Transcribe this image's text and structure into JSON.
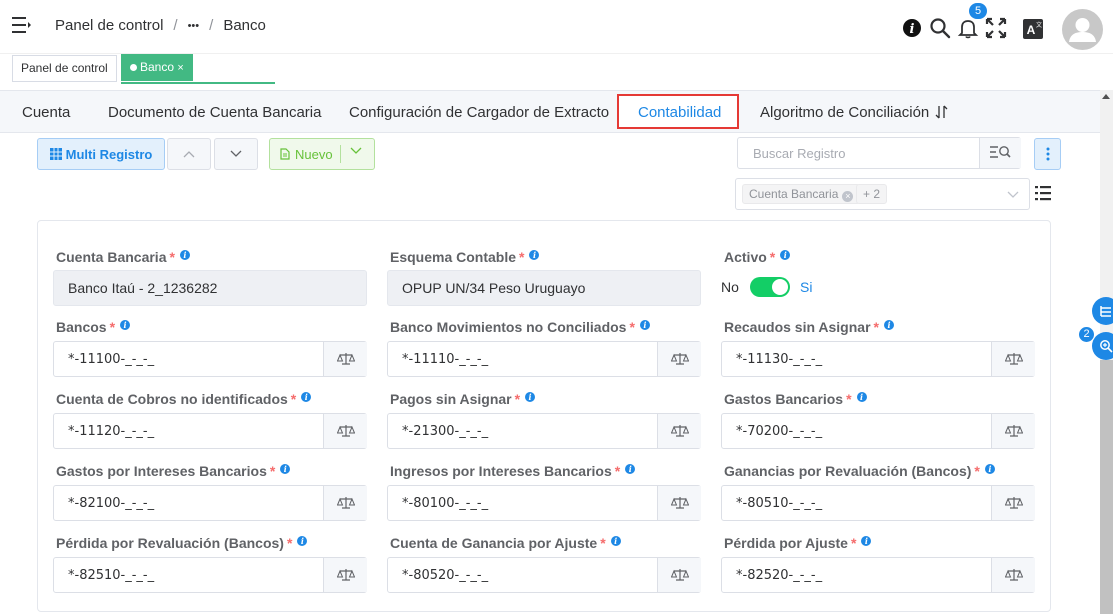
{
  "header": {
    "breadcrumb": [
      "Panel de control",
      "•••",
      "Banco"
    ],
    "notification_count": "5"
  },
  "tags": [
    "Panel de control",
    "Banco"
  ],
  "tabs": [
    "Cuenta",
    "Documento de Cuenta Bancaria",
    "Configuración de Cargador de Extracto",
    "Contabilidad",
    "Algoritmo de Conciliación"
  ],
  "toolbar": {
    "multi_registro": "Multi Registro",
    "nuevo": "Nuevo",
    "search_placeholder": "Buscar Registro",
    "filter_chip": "Cuenta Bancaria",
    "filter_more": "+ 2"
  },
  "form": {
    "cuenta_bancaria": {
      "label": "Cuenta Bancaria",
      "value": "Banco Itaú - 2_1236282"
    },
    "esquema_contable": {
      "label": "Esquema Contable",
      "value": "OPUP UN/34 Peso Uruguayo"
    },
    "activo": {
      "label": "Activo",
      "off": "No",
      "on": "Si"
    },
    "accounts": [
      {
        "label": "Bancos",
        "value": "*-11100-_-_-_"
      },
      {
        "label": "Banco Movimientos no Conciliados",
        "value": "*-11110-_-_-_"
      },
      {
        "label": "Recaudos sin Asignar",
        "value": "*-11130-_-_-_"
      },
      {
        "label": "Cuenta de Cobros no identificados",
        "value": "*-11120-_-_-_"
      },
      {
        "label": "Pagos sin Asignar",
        "value": "*-21300-_-_-_"
      },
      {
        "label": "Gastos Bancarios",
        "value": "*-70200-_-_-_"
      },
      {
        "label": "Gastos por Intereses Bancarios",
        "value": "*-82100-_-_-_"
      },
      {
        "label": "Ingresos por Intereses Bancarios",
        "value": "*-80100-_-_-_"
      },
      {
        "label": "Ganancias por Revaluación (Bancos)",
        "value": "*-80510-_-_-_"
      },
      {
        "label": "Pérdida por Revaluación (Bancos)",
        "value": "*-82510-_-_-_"
      },
      {
        "label": "Cuenta de Ganancia por Ajuste",
        "value": "*-80520-_-_-_"
      },
      {
        "label": "Pérdida por Ajuste",
        "value": "*-82520-_-_-_"
      }
    ]
  },
  "side_badge": "2"
}
